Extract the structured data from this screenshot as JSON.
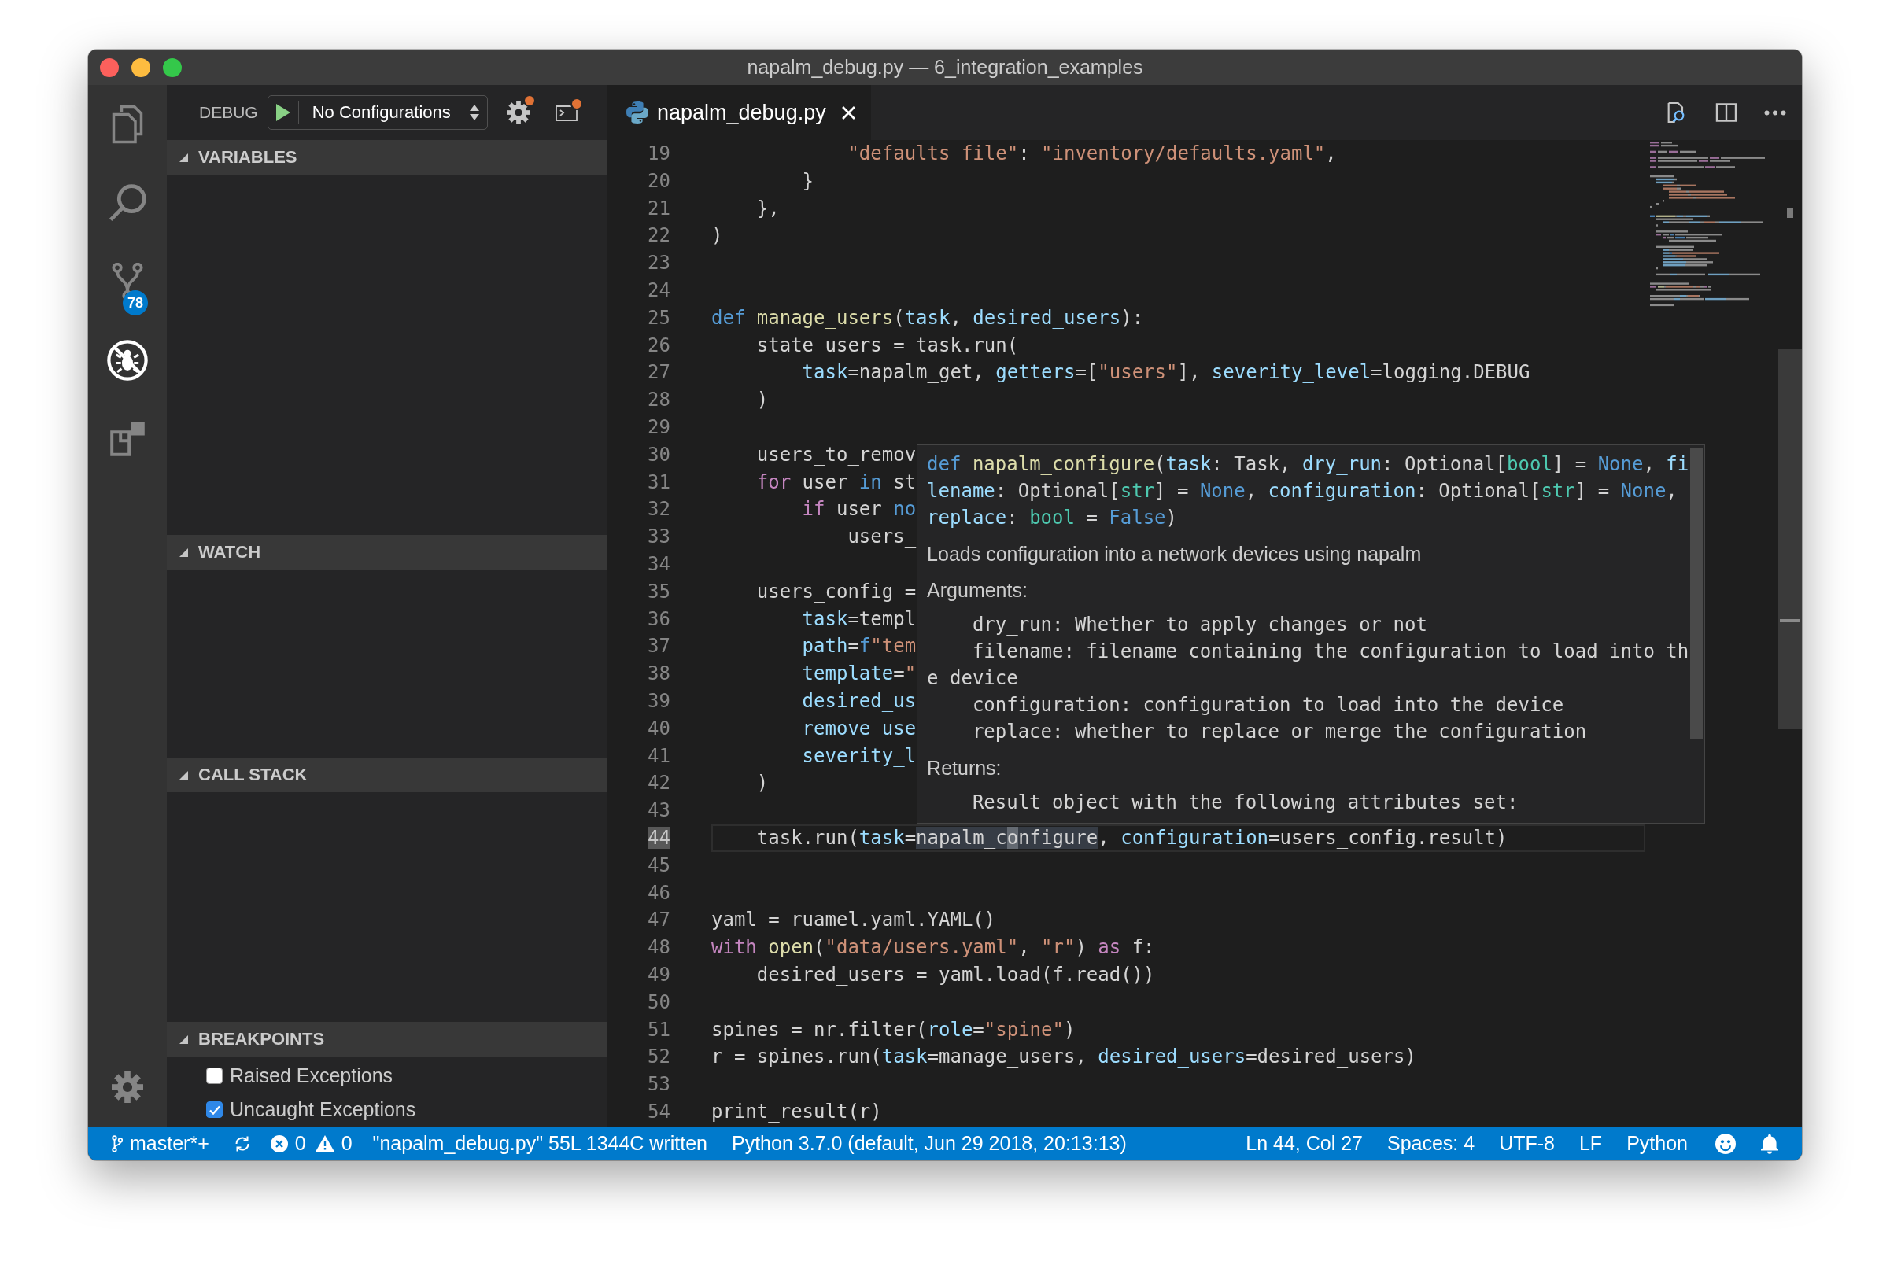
{
  "window": {
    "title": "napalm_debug.py — 6_integration_examples"
  },
  "activity_bar": {
    "items": [
      {
        "kind": "explorer",
        "selected": false
      },
      {
        "kind": "search",
        "selected": false
      },
      {
        "kind": "source_control",
        "selected": false,
        "badge": "78"
      },
      {
        "kind": "debug",
        "selected": true
      },
      {
        "kind": "extensions",
        "selected": false
      }
    ]
  },
  "debug_toolbar": {
    "label": "DEBUG",
    "configuration": "No Configurations"
  },
  "sidebar_sections": [
    {
      "title": "VARIABLES",
      "expanded": true
    },
    {
      "title": "WATCH",
      "expanded": true
    },
    {
      "title": "CALL STACK",
      "expanded": true
    },
    {
      "title": "BREAKPOINTS",
      "expanded": true,
      "items": [
        {
          "label": "Raised Exceptions",
          "checked": false
        },
        {
          "label": "Uncaught Exceptions",
          "checked": true
        }
      ]
    }
  ],
  "tabs": [
    {
      "label": "napalm_debug.py",
      "selected": true
    }
  ],
  "editor": {
    "lines": [
      {
        "number": "19",
        "current": false,
        "tokens": [
          {
            "text": "            \"defaults_file\"",
            "kind": "string"
          },
          {
            "text": ": ",
            "kind": "plain"
          },
          {
            "text": "\"inventory/defaults.yaml\"",
            "kind": "string"
          },
          {
            "text": ",",
            "kind": "plain"
          }
        ]
      },
      {
        "number": "20",
        "current": false,
        "tokens": [
          {
            "text": "        }",
            "kind": "plain"
          }
        ]
      },
      {
        "number": "21",
        "current": false,
        "tokens": [
          {
            "text": "    },",
            "kind": "plain"
          }
        ]
      },
      {
        "number": "22",
        "current": false,
        "tokens": [
          {
            "text": ")",
            "kind": "plain"
          }
        ]
      },
      {
        "number": "23",
        "current": false
      },
      {
        "number": "24",
        "current": false
      },
      {
        "number": "25",
        "current": false,
        "tokens": [
          {
            "text": "def",
            "kind": "keyword"
          },
          {
            "text": " manage_users",
            "kind": "function"
          },
          {
            "text": "(",
            "kind": "plain"
          },
          {
            "text": "task",
            "kind": "param"
          },
          {
            "text": ", ",
            "kind": "plain"
          },
          {
            "text": "desired_users",
            "kind": "param"
          },
          {
            "text": "):",
            "kind": "plain"
          }
        ]
      },
      {
        "number": "26",
        "current": false,
        "tokens": [
          {
            "text": "    state_users = task.run(",
            "kind": "plain"
          }
        ]
      },
      {
        "number": "27",
        "current": false,
        "tokens": [
          {
            "text": "        task",
            "kind": "param"
          },
          {
            "text": "=napalm_get, ",
            "kind": "plain"
          },
          {
            "text": "getters",
            "kind": "param"
          },
          {
            "text": "=[",
            "kind": "plain"
          },
          {
            "text": "\"users\"",
            "kind": "string"
          },
          {
            "text": "], ",
            "kind": "plain"
          },
          {
            "text": "severity_level",
            "kind": "param"
          },
          {
            "text": "=logging.DEBUG",
            "kind": "plain"
          }
        ]
      },
      {
        "number": "28",
        "current": false,
        "tokens": [
          {
            "text": "    )",
            "kind": "plain"
          }
        ]
      },
      {
        "number": "29",
        "current": false
      },
      {
        "number": "30",
        "current": false,
        "tokens": [
          {
            "text": "    users_to_remov",
            "kind": "plain"
          }
        ]
      },
      {
        "number": "31",
        "current": false,
        "tokens": [
          {
            "text": "    for",
            "kind": "control"
          },
          {
            "text": " user ",
            "kind": "plain"
          },
          {
            "text": "in",
            "kind": "keyword"
          },
          {
            "text": " st",
            "kind": "plain"
          }
        ]
      },
      {
        "number": "32",
        "current": false,
        "tokens": [
          {
            "text": "        if",
            "kind": "control"
          },
          {
            "text": " user ",
            "kind": "plain"
          },
          {
            "text": "no",
            "kind": "keyword"
          }
        ]
      },
      {
        "number": "33",
        "current": false,
        "tokens": [
          {
            "text": "            users_",
            "kind": "plain"
          }
        ]
      },
      {
        "number": "34",
        "current": false
      },
      {
        "number": "35",
        "current": false,
        "tokens": [
          {
            "text": "    users_config =",
            "kind": "plain"
          }
        ]
      },
      {
        "number": "36",
        "current": false,
        "tokens": [
          {
            "text": "        task",
            "kind": "param"
          },
          {
            "text": "=templ",
            "kind": "plain"
          }
        ]
      },
      {
        "number": "37",
        "current": false,
        "tokens": [
          {
            "text": "        path",
            "kind": "param"
          },
          {
            "text": "=",
            "kind": "plain"
          },
          {
            "text": "f",
            "kind": "keyword"
          },
          {
            "text": "\"tem",
            "kind": "string"
          }
        ]
      },
      {
        "number": "38",
        "current": false,
        "tokens": [
          {
            "text": "        template",
            "kind": "param"
          },
          {
            "text": "=",
            "kind": "plain"
          },
          {
            "text": "\"",
            "kind": "string"
          }
        ]
      },
      {
        "number": "39",
        "current": false,
        "tokens": [
          {
            "text": "        desired_us",
            "kind": "param"
          }
        ]
      },
      {
        "number": "40",
        "current": false,
        "tokens": [
          {
            "text": "        remove_use",
            "kind": "param"
          }
        ]
      },
      {
        "number": "41",
        "current": false,
        "tokens": [
          {
            "text": "        severity_l",
            "kind": "param"
          }
        ]
      },
      {
        "number": "42",
        "current": false,
        "tokens": [
          {
            "text": "    )",
            "kind": "plain"
          }
        ]
      },
      {
        "number": "43",
        "current": false
      },
      {
        "number": "44",
        "current": true,
        "tokens": [
          {
            "text": "    task.run(",
            "kind": "plain",
            "highlighted": false,
            "cursor": false
          },
          {
            "text": "task",
            "kind": "param",
            "highlighted": false,
            "cursor": false
          },
          {
            "text": "=",
            "kind": "plain",
            "highlighted": false,
            "cursor": false
          },
          {
            "text": "napalm_c",
            "kind": "plain",
            "highlighted": true,
            "cursor": false
          },
          {
            "text": "o",
            "kind": "plain",
            "highlighted": true,
            "cursor": true
          },
          {
            "text": "nfigure",
            "kind": "plain",
            "highlighted": true,
            "cursor": false
          },
          {
            "text": ", ",
            "kind": "plain",
            "highlighted": false,
            "cursor": false
          },
          {
            "text": "configuration",
            "kind": "param",
            "highlighted": false,
            "cursor": false
          },
          {
            "text": "=users_config.result)",
            "kind": "plain",
            "highlighted": false,
            "cursor": false
          }
        ]
      },
      {
        "number": "45",
        "current": false
      },
      {
        "number": "46",
        "current": false
      },
      {
        "number": "47",
        "current": false,
        "tokens": [
          {
            "text": "yaml = ruamel.yaml.YAML()",
            "kind": "plain"
          }
        ]
      },
      {
        "number": "48",
        "current": false,
        "tokens": [
          {
            "text": "with",
            "kind": "control"
          },
          {
            "text": " open",
            "kind": "function"
          },
          {
            "text": "(",
            "kind": "plain"
          },
          {
            "text": "\"data/users.yaml\"",
            "kind": "string"
          },
          {
            "text": ", ",
            "kind": "plain"
          },
          {
            "text": "\"r\"",
            "kind": "string"
          },
          {
            "text": ") ",
            "kind": "plain"
          },
          {
            "text": "as",
            "kind": "control"
          },
          {
            "text": " f:",
            "kind": "plain"
          }
        ]
      },
      {
        "number": "49",
        "current": false,
        "tokens": [
          {
            "text": "    desired_users = yaml.load(f.read())",
            "kind": "plain"
          }
        ]
      },
      {
        "number": "50",
        "current": false
      },
      {
        "number": "51",
        "current": false,
        "tokens": [
          {
            "text": "spines = nr.filter(",
            "kind": "plain"
          },
          {
            "text": "role",
            "kind": "param"
          },
          {
            "text": "=",
            "kind": "plain"
          },
          {
            "text": "\"spine\"",
            "kind": "string"
          },
          {
            "text": ")",
            "kind": "plain"
          }
        ]
      },
      {
        "number": "52",
        "current": false,
        "tokens": [
          {
            "text": "r = spines.run(",
            "kind": "plain"
          },
          {
            "text": "task",
            "kind": "param"
          },
          {
            "text": "=manage_users, ",
            "kind": "plain"
          },
          {
            "text": "desired_users",
            "kind": "param"
          },
          {
            "text": "=desired_users)",
            "kind": "plain"
          }
        ]
      },
      {
        "number": "53",
        "current": false
      },
      {
        "number": "54",
        "current": false,
        "tokens": [
          {
            "text": "print_result(r)",
            "kind": "plain"
          }
        ]
      }
    ],
    "hover": {
      "signature": [
        {
          "text": "def",
          "kind": "keyword"
        },
        {
          "text": " napalm_configure",
          "kind": "function"
        },
        {
          "text": "(",
          "kind": "plain"
        },
        {
          "text": "task",
          "kind": "param"
        },
        {
          "text": ": Task, ",
          "kind": "plain"
        },
        {
          "text": "dry_run",
          "kind": "param"
        },
        {
          "text": ": Optional[",
          "kind": "plain"
        },
        {
          "text": "bool",
          "kind": "type"
        },
        {
          "text": "] = ",
          "kind": "plain"
        },
        {
          "text": "None",
          "kind": "constant"
        },
        {
          "text": ", ",
          "kind": "plain"
        },
        {
          "text": "filename",
          "kind": "param"
        },
        {
          "text": ": Optional[",
          "kind": "plain"
        },
        {
          "text": "str",
          "kind": "type"
        },
        {
          "text": "] = ",
          "kind": "plain"
        },
        {
          "text": "None",
          "kind": "constant"
        },
        {
          "text": ", ",
          "kind": "plain"
        },
        {
          "text": "configuration",
          "kind": "param"
        },
        {
          "text": ": Optional[",
          "kind": "plain"
        },
        {
          "text": "str",
          "kind": "type"
        },
        {
          "text": "] = ",
          "kind": "plain"
        },
        {
          "text": "None",
          "kind": "constant"
        },
        {
          "text": ", ",
          "kind": "plain"
        },
        {
          "text": "replace",
          "kind": "param"
        },
        {
          "text": ": ",
          "kind": "plain"
        },
        {
          "text": "bool",
          "kind": "type"
        },
        {
          "text": " = ",
          "kind": "plain"
        },
        {
          "text": "False",
          "kind": "constant"
        },
        {
          "text": ")",
          "kind": "plain"
        }
      ],
      "summary": "Loads configuration into a network devices using napalm",
      "sections": [
        {
          "heading": "Arguments:",
          "lines": [
            "    dry_run: Whether to apply changes or not",
            "    filename: filename containing the configuration to load into the device",
            "    configuration: configuration to load into the device",
            "    replace: whether to replace or merge the configuration"
          ]
        },
        {
          "heading": "Returns:",
          "lines": [
            "    Result object with the following attributes set:"
          ]
        }
      ]
    }
  },
  "status_bar": {
    "branch": "master*+",
    "errors": "0",
    "warnings": "0",
    "message": "\"napalm_debug.py\" 55L 1344C written",
    "interpreter": "Python 3.7.0 (default, Jun 29 2018, 20:13:13)",
    "cursor_position": "Ln 44, Col 27",
    "indentation": "Spaces: 4",
    "encoding": "UTF-8",
    "line_ending": "LF",
    "language": "Python"
  }
}
